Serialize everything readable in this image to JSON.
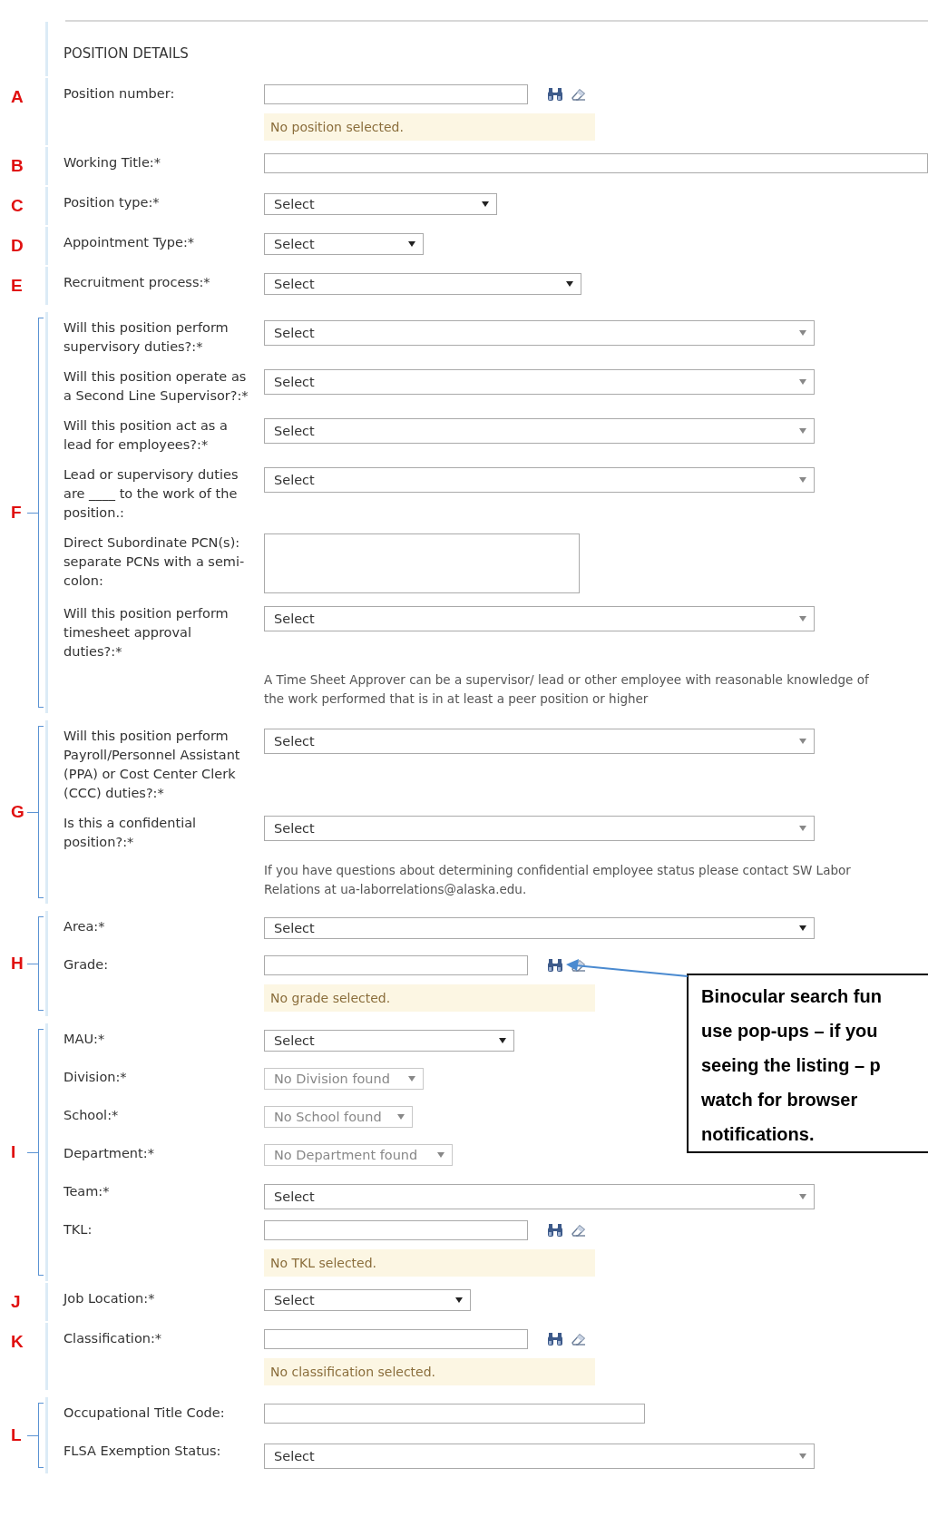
{
  "section_title": "POSITION DETAILS",
  "groups": [
    {
      "marker": "A",
      "bracket": false,
      "rows": [
        {
          "label": "Position number:",
          "kind": "lookup",
          "message": "No position selected."
        }
      ]
    },
    {
      "marker": "B",
      "bracket": false,
      "rows": [
        {
          "label": "Working Title:*",
          "kind": "text"
        }
      ]
    },
    {
      "marker": "C",
      "bracket": false,
      "rows": [
        {
          "label": "Position type:*",
          "kind": "select",
          "value": "Select",
          "disabled": false
        }
      ]
    },
    {
      "marker": "D",
      "bracket": false,
      "rows": [
        {
          "label": "Appointment Type:*",
          "kind": "select",
          "value": "Select",
          "disabled": false
        }
      ]
    },
    {
      "marker": "E",
      "bracket": false,
      "rows": [
        {
          "label": "Recruitment process:*",
          "kind": "select",
          "value": "Select",
          "disabled": false
        }
      ]
    },
    {
      "marker": "F",
      "bracket": true,
      "rows": [
        {
          "label": "Will this position perform supervisory duties?:*",
          "kind": "select",
          "value": "Select",
          "disabled": false
        },
        {
          "label": "Will this position operate as a Second Line Supervisor?:*",
          "kind": "select",
          "value": "Select",
          "disabled": false
        },
        {
          "label": "Will this position act as a lead for employees?:*",
          "kind": "select",
          "value": "Select",
          "disabled": false
        },
        {
          "label": "Lead or supervisory duties are ____ to the work of the position.:",
          "kind": "select",
          "value": "Select",
          "disabled": false
        },
        {
          "label": "Direct Subordinate PCN(s): separate PCNs with a semi-colon:",
          "kind": "textarea"
        },
        {
          "label": "Will this position perform timesheet approval duties?:*",
          "kind": "select",
          "value": "Select",
          "disabled": false
        },
        {
          "kind": "note",
          "text": "A Time Sheet Approver can be a supervisor/ lead or other employee with reasonable knowledge of the work performed that is in at least a peer position or higher"
        }
      ]
    },
    {
      "marker": "G",
      "bracket": true,
      "rows": [
        {
          "label": "Will this position perform Payroll/Personnel Assistant (PPA) or Cost Center Clerk (CCC) duties?:*",
          "kind": "select",
          "value": "Select",
          "disabled": false
        },
        {
          "label": "Is this a confidential position?:*",
          "kind": "select",
          "value": "Select",
          "disabled": false
        },
        {
          "kind": "note",
          "text": "If you have questions about determining confidential employee status please contact SW Labor Relations at ua-laborrelations@alaska.edu."
        }
      ]
    },
    {
      "marker": "H",
      "bracket": true,
      "rows": [
        {
          "label": "Area:*",
          "kind": "select",
          "value": "Select",
          "disabled": false
        },
        {
          "label": "Grade:",
          "kind": "lookup",
          "message": "No grade selected."
        }
      ]
    },
    {
      "marker": "I",
      "bracket": true,
      "rows": [
        {
          "label": "MAU:*",
          "kind": "select",
          "value": "Select",
          "disabled": false
        },
        {
          "label": "Division:*",
          "kind": "select",
          "value": "No Division found",
          "disabled": true
        },
        {
          "label": "School:*",
          "kind": "select",
          "value": "No School found",
          "disabled": true
        },
        {
          "label": "Department:*",
          "kind": "select",
          "value": "No Department found",
          "disabled": true
        },
        {
          "label": "Team:*",
          "kind": "select",
          "value": "Select",
          "disabled": false
        },
        {
          "label": "TKL:",
          "kind": "lookup",
          "message": "No TKL selected."
        }
      ]
    },
    {
      "marker": "J",
      "bracket": false,
      "rows": [
        {
          "label": "Job Location:*",
          "kind": "select",
          "value": "Select",
          "disabled": false
        }
      ]
    },
    {
      "marker": "K",
      "bracket": false,
      "rows": [
        {
          "label": "Classification:*",
          "kind": "lookup",
          "message": "No classification selected."
        }
      ]
    },
    {
      "marker": "L",
      "bracket": true,
      "rows": [
        {
          "label": "Occupational Title Code:",
          "kind": "text"
        },
        {
          "label": "FLSA Exemption Status:",
          "kind": "select",
          "value": "Select",
          "disabled": false
        }
      ]
    }
  ],
  "callout": {
    "lines": [
      "Binocular search fun",
      "use pop-ups – if you",
      "seeing the listing – p",
      "watch for browser",
      "notifications."
    ]
  }
}
